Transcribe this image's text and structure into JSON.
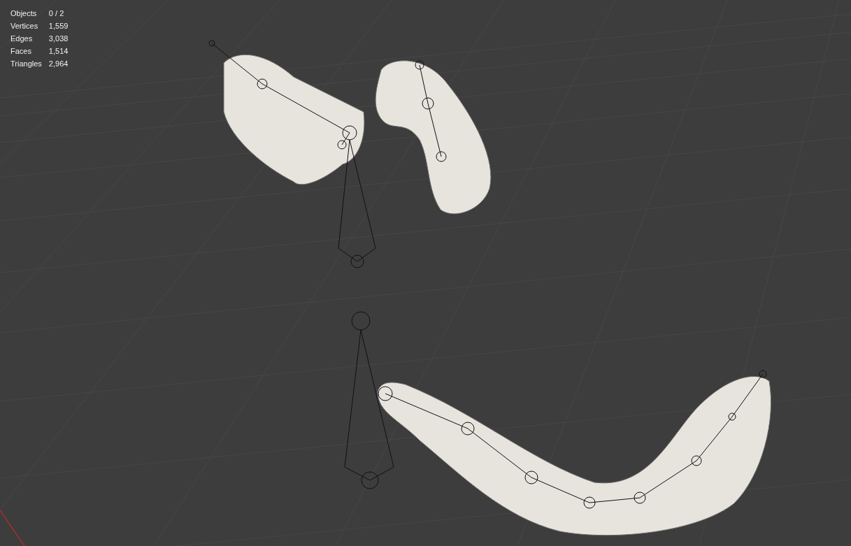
{
  "stats": [
    {
      "label": "Objects",
      "value": "0 / 2"
    },
    {
      "label": "Vertices",
      "value": "1,559"
    },
    {
      "label": "Edges",
      "value": "3,038"
    },
    {
      "label": "Faces",
      "value": "1,514"
    },
    {
      "label": "Triangles",
      "value": "2,964"
    }
  ]
}
